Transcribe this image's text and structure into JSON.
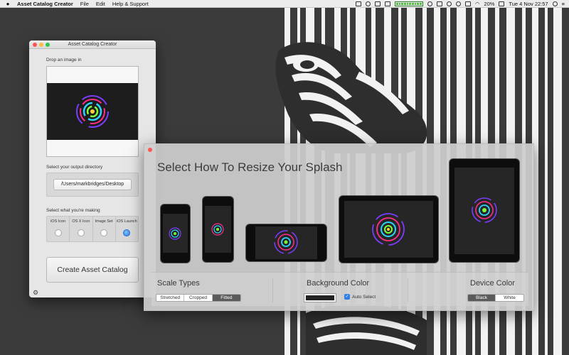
{
  "menubar": {
    "app_name": "Asset Catalog Creator",
    "items": [
      "File",
      "Edit",
      "Help & Support"
    ],
    "battery_percent": "20%",
    "datetime": "Tue 4 Nov  22:57"
  },
  "main_window": {
    "title": "Asset Catalog Creator",
    "drop_label": "Drop an image in",
    "output_label": "Select your output directory",
    "output_path": "/Users/markbridges/Desktop",
    "making_label": "Select what you're making",
    "options": [
      {
        "label": "iOS Icon",
        "selected": false
      },
      {
        "label": "OS X Icon",
        "selected": false
      },
      {
        "label": "Image Set",
        "selected": false
      },
      {
        "label": "iOS Launch",
        "selected": true
      }
    ],
    "create_button": "Create Asset Catalog"
  },
  "splash_panel": {
    "title": "Select How To Resize Your Splash",
    "scale_types_label": "Scale Types",
    "scale_types": [
      "Stretched",
      "Cropped",
      "Fitted"
    ],
    "scale_selected": "Fitted",
    "background_color_label": "Background Color",
    "background_color": "#222222",
    "auto_select_label": "Auto Select",
    "auto_select_checked": true,
    "device_color_label": "Device Color",
    "device_colors": [
      "Black",
      "White"
    ],
    "device_selected": "Black"
  },
  "colors": {
    "accent": "#2f7fe6",
    "wallpaper": "#3b3b3b"
  }
}
